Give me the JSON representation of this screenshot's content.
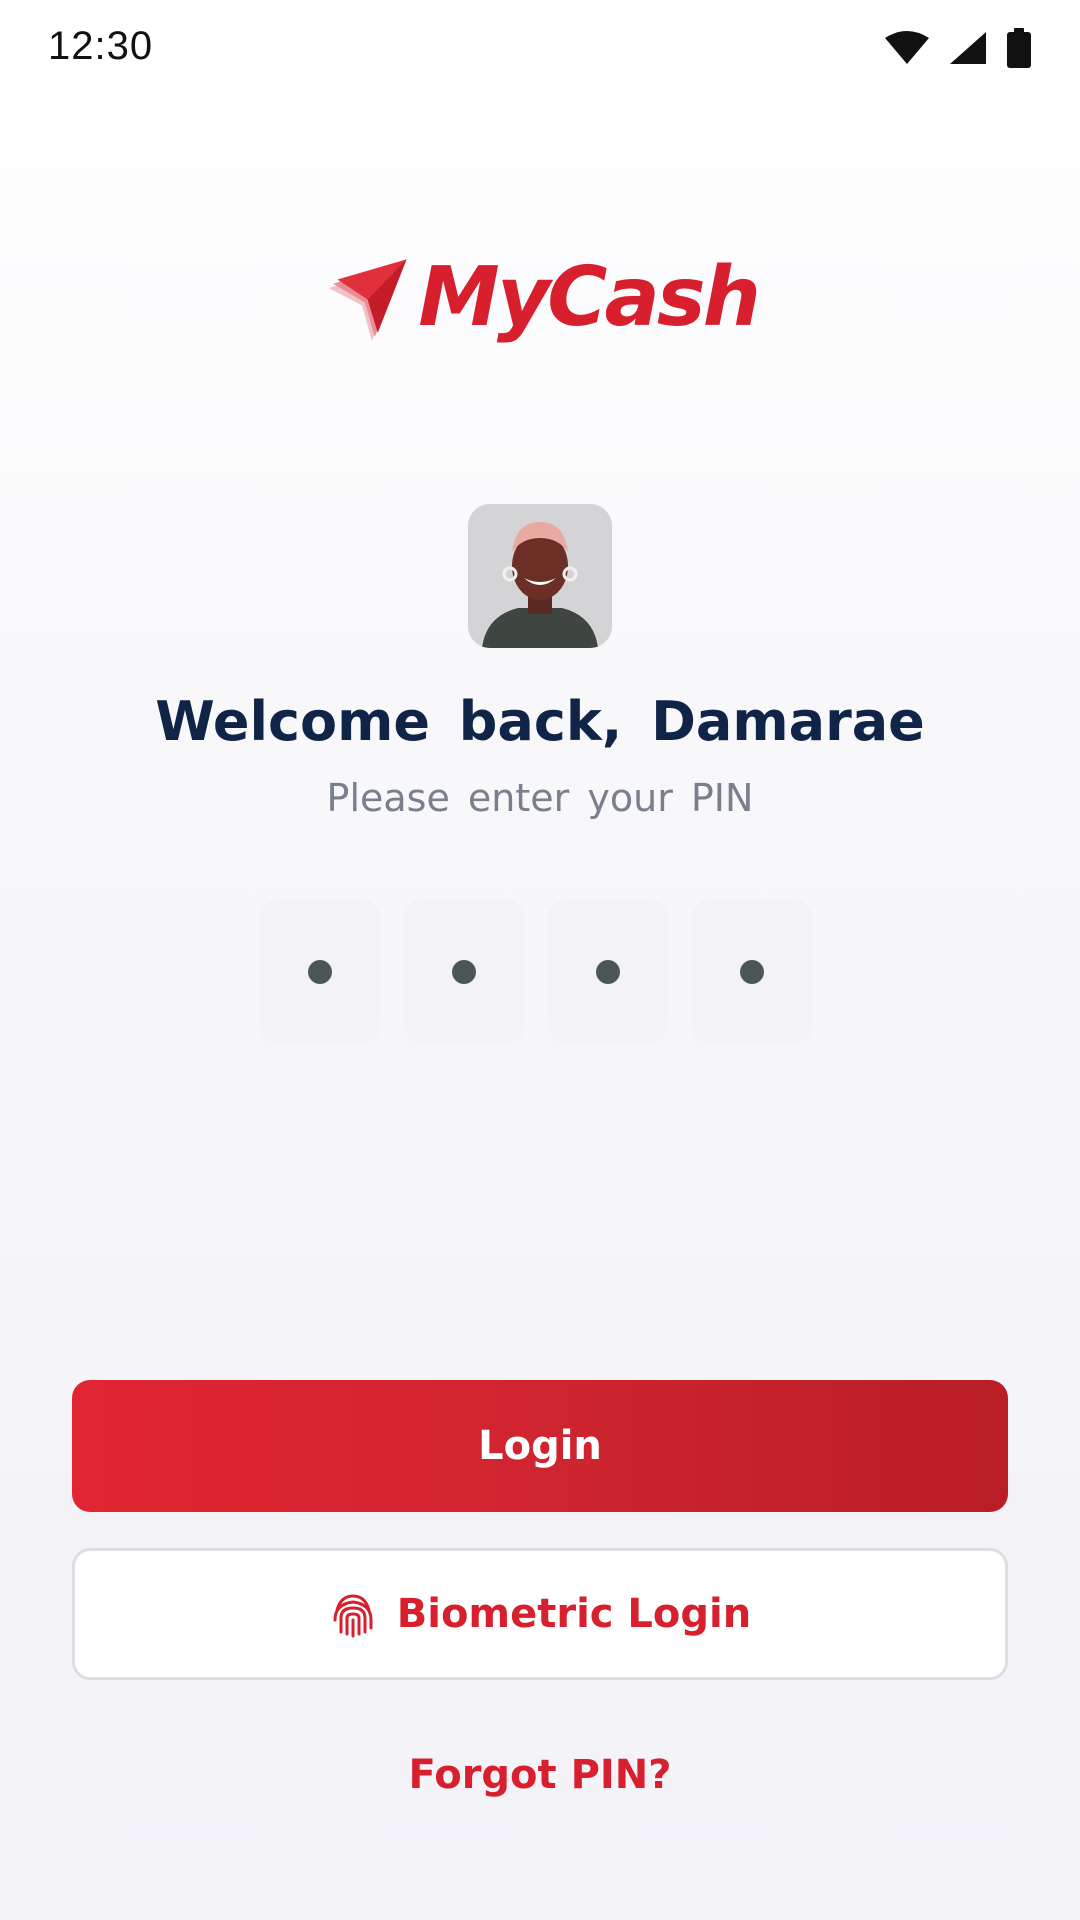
{
  "status_bar": {
    "time": "12:30",
    "icons": [
      "wifi-icon",
      "signal-icon",
      "battery-icon"
    ]
  },
  "brand": {
    "name": "MyCash",
    "accent_color": "#d81f2e",
    "logo_icon": "paper-plane-icon"
  },
  "profile": {
    "avatar": "user-avatar-photo",
    "welcome_text": "Welcome back, Damarae",
    "subtitle": "Please enter your PIN"
  },
  "pin": {
    "length": 4,
    "filled": 4
  },
  "actions": {
    "login_label": "Login",
    "biometric_label": "Biometric Login",
    "biometric_icon": "fingerprint-icon",
    "forgot_label": "Forgot PIN?"
  }
}
